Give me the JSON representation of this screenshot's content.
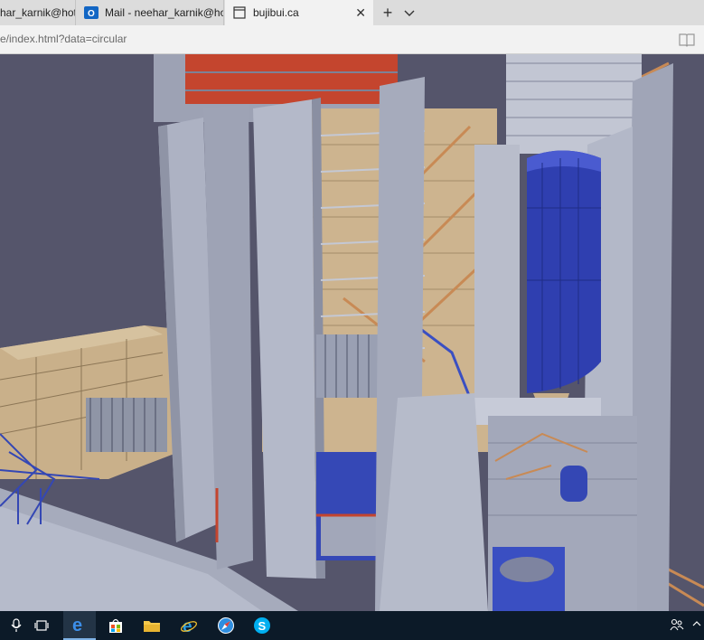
{
  "browser": {
    "tabs": [
      {
        "label": "har_karnik@hotm",
        "icon": "page-icon"
      },
      {
        "label": "Mail - neehar_karnik@hotm",
        "icon": "outlook-icon"
      },
      {
        "label": "bujibui.ca",
        "icon": "page-icon",
        "active": true,
        "close": "✕"
      }
    ],
    "new_tab": "+",
    "address": "e/index.html?data=circular"
  },
  "viewer": {
    "colors": {
      "background": "#54546a",
      "structure": "#a9aec0",
      "equipment_blue": "#2f3fb0",
      "piping_orange": "#c88a55",
      "accent_red": "#c4452e",
      "tan": "#c9b08a"
    }
  },
  "taskbar": {
    "items": [
      "mic-icon",
      "task-view-icon",
      "edge-icon",
      "store-icon",
      "file-explorer-icon",
      "ie-icon",
      "safari-icon",
      "skype-icon"
    ],
    "tray": "people-icon"
  }
}
